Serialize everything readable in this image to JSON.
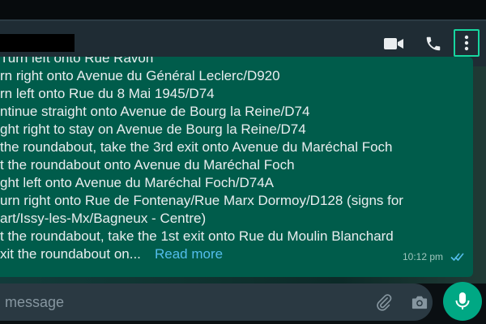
{
  "header": {
    "contact_name": "",
    "video_call_icon": "video-camera",
    "voice_call_icon": "phone",
    "menu_icon": "three-dots-vertical"
  },
  "message": {
    "lines": [
      "Turn left onto Rue Ravon",
      "rn right onto Avenue du Général Leclerc/D920",
      "rn left onto Rue du 8 Mai 1945/D74",
      "ntinue straight onto Avenue de Bourg la Reine/D74",
      "ght right to stay on Avenue de Bourg la Reine/D74",
      "the roundabout, take the 3rd exit onto Avenue du Maréchal Foch",
      "t the roundabout onto Avenue du Maréchal Foch",
      "ght left onto Avenue du Maréchal Foch/D74A",
      "urn right onto Rue de Fontenay/Rue Marx Dormoy/D128 (signs for",
      "art/Issy-les-Mx/Bagneux - Centre)",
      "t the roundabout, take the 1st exit onto Rue du Moulin Blanchard",
      "xit the roundabout on..."
    ],
    "read_more": "Read more",
    "time": "10:12 pm",
    "status": "read"
  },
  "composer": {
    "placeholder": "message",
    "attach_icon": "paperclip",
    "camera_icon": "camera",
    "mic_icon": "microphone"
  },
  "colors": {
    "header_bg": "#1f2c34",
    "bubble_bg": "#005c4b",
    "link": "#53bdeb",
    "accent": "#00a884"
  }
}
